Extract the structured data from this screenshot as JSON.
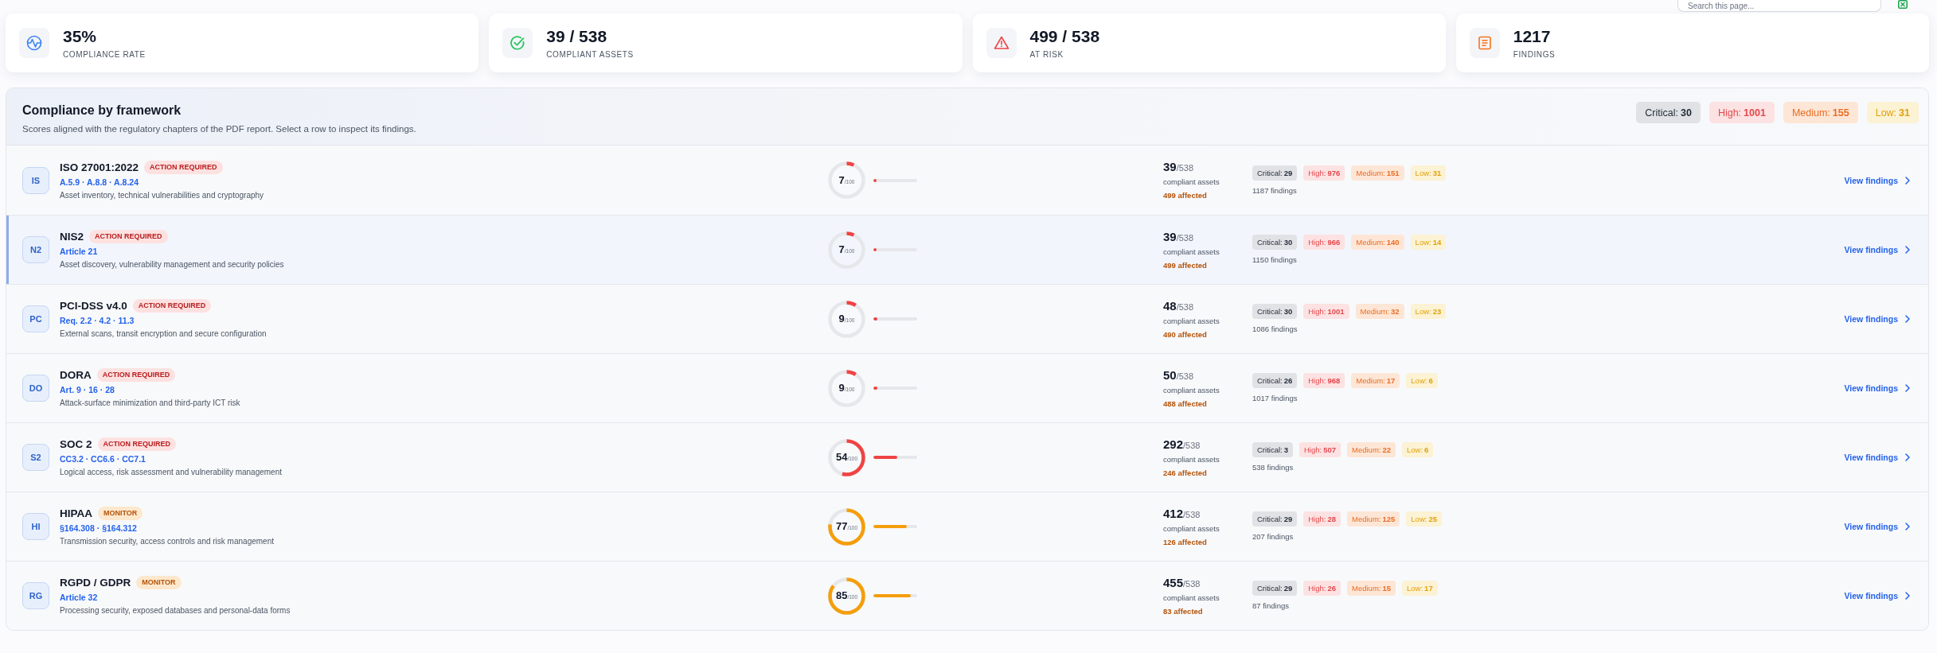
{
  "toolbar": {
    "search": {
      "placeholder": "Search this page..."
    }
  },
  "kpis": [
    {
      "kind": "rate",
      "value": "35%",
      "label": "COMPLIANCE RATE"
    },
    {
      "kind": "compliant",
      "value": "39 / 538",
      "label": "COMPLIANT ASSETS"
    },
    {
      "kind": "risk",
      "value": "499 / 538",
      "label": "AT RISK"
    },
    {
      "kind": "findings",
      "value": "1217",
      "label": "FINDINGS"
    }
  ],
  "panel": {
    "title": "Compliance by framework",
    "subtitle": "Scores aligned with the regulatory chapters of the PDF report. Select a row to inspect its findings.",
    "totals": [
      {
        "kind": "critical",
        "label": "Critical:",
        "value": "30"
      },
      {
        "kind": "high",
        "label": "High:",
        "value": "1001"
      },
      {
        "kind": "medium",
        "label": "Medium:",
        "value": "155"
      },
      {
        "kind": "low",
        "label": "Low:",
        "value": "31"
      }
    ]
  },
  "frameworks": [
    {
      "initials": "IS",
      "name": "ISO 27001:2022",
      "status": {
        "kind": "action",
        "label": "ACTION REQUIRED"
      },
      "reference": "A.5.9 · A.8.8 · A.8.24",
      "description": "Asset inventory, technical vulnerabilities and cryptography",
      "score": {
        "value": "7",
        "max": "/100",
        "level": 0.07
      },
      "assets": {
        "compliant": "39",
        "total": "/538",
        "caption": "compliant assets",
        "affected": "499 affected"
      },
      "severities": [
        {
          "kind": "critical",
          "label": "Critical:",
          "value": "29"
        },
        {
          "kind": "high",
          "label": "High:",
          "value": "976"
        },
        {
          "kind": "medium",
          "label": "Medium:",
          "value": "151"
        },
        {
          "kind": "low",
          "label": "Low:",
          "value": "31"
        }
      ],
      "findings_total": "1187 findings",
      "action": "View findings",
      "selected": false
    },
    {
      "initials": "N2",
      "name": "NIS2",
      "status": {
        "kind": "action",
        "label": "ACTION REQUIRED"
      },
      "reference": "Article 21",
      "description": "Asset discovery, vulnerability management and security policies",
      "score": {
        "value": "7",
        "max": "/100",
        "level": 0.07
      },
      "assets": {
        "compliant": "39",
        "total": "/538",
        "caption": "compliant assets",
        "affected": "499 affected"
      },
      "severities": [
        {
          "kind": "critical",
          "label": "Critical:",
          "value": "30"
        },
        {
          "kind": "high",
          "label": "High:",
          "value": "966"
        },
        {
          "kind": "medium",
          "label": "Medium:",
          "value": "140"
        },
        {
          "kind": "low",
          "label": "Low:",
          "value": "14"
        }
      ],
      "findings_total": "1150 findings",
      "action": "View findings",
      "selected": true
    },
    {
      "initials": "PC",
      "name": "PCI-DSS v4.0",
      "status": {
        "kind": "action",
        "label": "ACTION REQUIRED"
      },
      "reference": "Req. 2.2 · 4.2 · 11.3",
      "description": "External scans, transit encryption and secure configuration",
      "score": {
        "value": "9",
        "max": "/100",
        "level": 0.09
      },
      "assets": {
        "compliant": "48",
        "total": "/538",
        "caption": "compliant assets",
        "affected": "490 affected"
      },
      "severities": [
        {
          "kind": "critical",
          "label": "Critical:",
          "value": "30"
        },
        {
          "kind": "high",
          "label": "High:",
          "value": "1001"
        },
        {
          "kind": "medium",
          "label": "Medium:",
          "value": "32"
        },
        {
          "kind": "low",
          "label": "Low:",
          "value": "23"
        }
      ],
      "findings_total": "1086 findings",
      "action": "View findings",
      "selected": false
    },
    {
      "initials": "DO",
      "name": "DORA",
      "status": {
        "kind": "action",
        "label": "ACTION REQUIRED"
      },
      "reference": "Art. 9 · 16 · 28",
      "description": "Attack-surface minimization and third-party ICT risk",
      "score": {
        "value": "9",
        "max": "/100",
        "level": 0.09
      },
      "assets": {
        "compliant": "50",
        "total": "/538",
        "caption": "compliant assets",
        "affected": "488 affected"
      },
      "severities": [
        {
          "kind": "critical",
          "label": "Critical:",
          "value": "26"
        },
        {
          "kind": "high",
          "label": "High:",
          "value": "968"
        },
        {
          "kind": "medium",
          "label": "Medium:",
          "value": "17"
        },
        {
          "kind": "low",
          "label": "Low:",
          "value": "6"
        }
      ],
      "findings_total": "1017 findings",
      "action": "View findings",
      "selected": false
    },
    {
      "initials": "S2",
      "name": "SOC 2",
      "status": {
        "kind": "action",
        "label": "ACTION REQUIRED"
      },
      "reference": "CC3.2 · CC6.6 · CC7.1",
      "description": "Logical access, risk assessment and vulnerability management",
      "score": {
        "value": "54",
        "max": "/100",
        "level": 0.54
      },
      "assets": {
        "compliant": "292",
        "total": "/538",
        "caption": "compliant assets",
        "affected": "246 affected"
      },
      "severities": [
        {
          "kind": "critical",
          "label": "Critical:",
          "value": "3"
        },
        {
          "kind": "high",
          "label": "High:",
          "value": "507"
        },
        {
          "kind": "medium",
          "label": "Medium:",
          "value": "22"
        },
        {
          "kind": "low",
          "label": "Low:",
          "value": "6"
        }
      ],
      "findings_total": "538 findings",
      "action": "View findings",
      "selected": false
    },
    {
      "initials": "HI",
      "name": "HIPAA",
      "status": {
        "kind": "monitor",
        "label": "MONITOR"
      },
      "reference": "§164.308 · §164.312",
      "description": "Transmission security, access controls and risk management",
      "score": {
        "value": "77",
        "max": "/100",
        "level": 0.77
      },
      "assets": {
        "compliant": "412",
        "total": "/538",
        "caption": "compliant assets",
        "affected": "126 affected"
      },
      "severities": [
        {
          "kind": "critical",
          "label": "Critical:",
          "value": "29"
        },
        {
          "kind": "high",
          "label": "High:",
          "value": "28"
        },
        {
          "kind": "medium",
          "label": "Medium:",
          "value": "125"
        },
        {
          "kind": "low",
          "label": "Low:",
          "value": "25"
        }
      ],
      "findings_total": "207 findings",
      "action": "View findings",
      "selected": false
    },
    {
      "initials": "RG",
      "name": "RGPD / GDPR",
      "status": {
        "kind": "monitor",
        "label": "MONITOR"
      },
      "reference": "Article 32",
      "description": "Processing security, exposed databases and personal-data forms",
      "score": {
        "value": "85",
        "max": "/100",
        "level": 0.85
      },
      "assets": {
        "compliant": "455",
        "total": "/538",
        "caption": "compliant assets",
        "affected": "83 affected"
      },
      "severities": [
        {
          "kind": "critical",
          "label": "Critical:",
          "value": "29"
        },
        {
          "kind": "high",
          "label": "High:",
          "value": "26"
        },
        {
          "kind": "medium",
          "label": "Medium:",
          "value": "15"
        },
        {
          "kind": "low",
          "label": "Low:",
          "value": "17"
        }
      ],
      "findings_total": "87 findings",
      "action": "View findings",
      "selected": false
    }
  ]
}
